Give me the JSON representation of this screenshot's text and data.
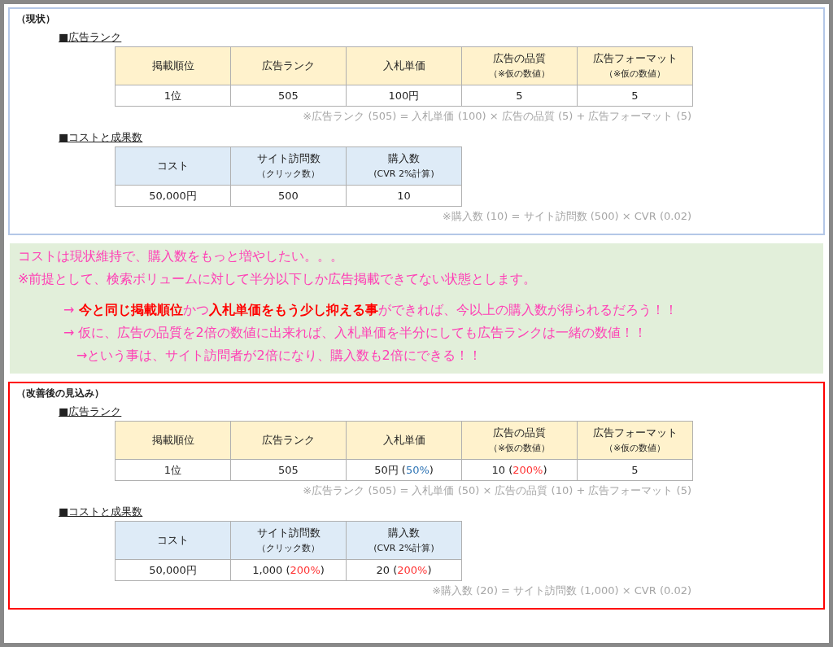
{
  "sections": [
    {
      "title": "（現状）",
      "color": "#b4c7e7",
      "tables": [
        {
          "heading": "■広告ランク",
          "kind": "rank",
          "columns": [
            {
              "main": "掲載順位"
            },
            {
              "main": "広告ランク"
            },
            {
              "main": "入札単価"
            },
            {
              "main": "広告の品質",
              "sub": "（※仮の数値）"
            },
            {
              "main": "広告フォーマット",
              "sub": "（※仮の数値）"
            }
          ],
          "row": [
            [
              {
                "text": "1位"
              }
            ],
            [
              {
                "text": "505"
              }
            ],
            [
              {
                "text": "100円"
              }
            ],
            [
              {
                "text": "5"
              }
            ],
            [
              {
                "text": "5"
              }
            ]
          ],
          "note": "※広告ランク (505) = 入札単価 (100) × 広告の品質 (5) + 広告フォーマット (5)"
        },
        {
          "heading": "■コストと成果数",
          "kind": "cost",
          "columns": [
            {
              "main": "コスト"
            },
            {
              "main": "サイト訪問数",
              "sub": "（クリック数）"
            },
            {
              "main": "購入数",
              "sub": "(CVR 2%計算)"
            }
          ],
          "row": [
            [
              {
                "text": "50,000円"
              }
            ],
            [
              {
                "text": "500"
              }
            ],
            [
              {
                "text": "10"
              }
            ]
          ],
          "note": "※購入数 (10) = サイト訪問数 (500) × CVR (0.02)"
        }
      ]
    },
    {
      "kind": "message",
      "lines": [
        {
          "indent": false,
          "parts": [
            {
              "text": "コストは現状維持で、購入数をもっと増やしたい。。。",
              "emphasis": false
            }
          ]
        },
        {
          "indent": false,
          "parts": [
            {
              "text": "※前提として、検索ボリュームに対して半分以下しか広告掲載できてない状態とします。",
              "emphasis": false
            }
          ]
        },
        {
          "indent": true,
          "gap": true,
          "parts": [
            {
              "text": "→ ",
              "emphasis": false
            },
            {
              "text": "今と同じ掲載順位",
              "emphasis": true
            },
            {
              "text": "かつ",
              "emphasis": false
            },
            {
              "text": "入札単価をもう少し抑える事",
              "emphasis": true
            },
            {
              "text": "ができれば、今以上の購入数が得られるだろう！！",
              "emphasis": false
            }
          ]
        },
        {
          "indent": true,
          "parts": [
            {
              "text": "→ 仮に、広告の品質を2倍の数値に出来れば、入札単価を半分にしても広告ランクは一緒の数値！！",
              "emphasis": false
            }
          ]
        },
        {
          "indent": true,
          "extra": true,
          "parts": [
            {
              "text": "→という事は、サイト訪問者が2倍になり、購入数も2倍にできる！！",
              "emphasis": false
            }
          ]
        }
      ]
    },
    {
      "title": "（改善後の見込み）",
      "color": "#ff0000",
      "tables": [
        {
          "heading": "■広告ランク",
          "kind": "rank",
          "columns": [
            {
              "main": "掲載順位"
            },
            {
              "main": "広告ランク"
            },
            {
              "main": "入札単価"
            },
            {
              "main": "広告の品質",
              "sub": "（※仮の数値）"
            },
            {
              "main": "広告フォーマット",
              "sub": "（※仮の数値）"
            }
          ],
          "row": [
            [
              {
                "text": "1位"
              }
            ],
            [
              {
                "text": "505"
              }
            ],
            [
              {
                "text": "50円 ("
              },
              {
                "text": "50%",
                "color": "#2e75b6"
              },
              {
                "text": ")"
              }
            ],
            [
              {
                "text": "10 ("
              },
              {
                "text": "200%",
                "color": "#ff3333"
              },
              {
                "text": ")"
              }
            ],
            [
              {
                "text": "5"
              }
            ]
          ],
          "note": "※広告ランク (505) = 入札単価 (50) × 広告の品質 (10) + 広告フォーマット (5)"
        },
        {
          "heading": "■コストと成果数",
          "kind": "cost",
          "columns": [
            {
              "main": "コスト"
            },
            {
              "main": "サイト訪問数",
              "sub": "（クリック数）"
            },
            {
              "main": "購入数",
              "sub": "(CVR 2%計算)"
            }
          ],
          "row": [
            [
              {
                "text": "50,000円"
              }
            ],
            [
              {
                "text": "1,000 ("
              },
              {
                "text": "200%",
                "color": "#ff3333"
              },
              {
                "text": ")"
              }
            ],
            [
              {
                "text": "20 ("
              },
              {
                "text": "200%",
                "color": "#ff3333"
              },
              {
                "text": ")"
              }
            ]
          ],
          "note": "※購入数 (20) = サイト訪問数 (1,000) × CVR (0.02)"
        }
      ]
    }
  ]
}
